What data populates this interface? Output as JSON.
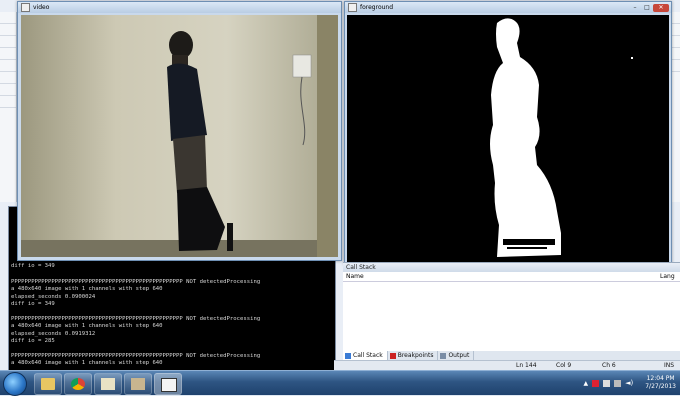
{
  "windows": {
    "video": {
      "title": "video"
    },
    "foreground": {
      "title": "foreground"
    }
  },
  "console": {
    "top_line": "diff io = 349",
    "lines": [
      "PPPPPPPPPPPPPPPPPPPPPPPPPPPPPPPPPPPPPPPPPPPPPPPPPPP NOT detectedProcessing",
      "a 480x640 image with 1 channels with step 640",
      "elapsed_seconds 0.0900024",
      "diff io = 349",
      "",
      "PPPPPPPPPPPPPPPPPPPPPPPPPPPPPPPPPPPPPPPPPPPPPPPPPPP NOT detectedProcessing",
      "a 480x640 image with 1 channels with step 640",
      "elapsed_seconds 0.0919312",
      "diff io = 285",
      "",
      "PPPPPPPPPPPPPPPPPPPPPPPPPPPPPPPPPPPPPPPPPPPPPPPPPPP NOT detectedProcessing",
      "a 480x640 image with 1 channels with step 640"
    ]
  },
  "callstack": {
    "title": "Call Stack",
    "col_name": "Name",
    "col_lang": "Lang",
    "tabs": [
      "Call Stack",
      "Breakpoints",
      "Output"
    ]
  },
  "statusbar": {
    "ln": "Ln 144",
    "col": "Col 9",
    "ch": "Ch 6",
    "mode": "INS"
  },
  "taskbar": {
    "time": "12:04 PM",
    "date": "7/27/2013"
  }
}
